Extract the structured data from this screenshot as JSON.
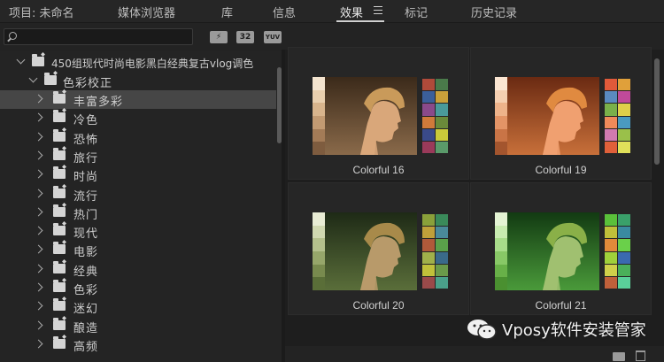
{
  "tabs": [
    {
      "label": "项目: 未命名",
      "active": false
    },
    {
      "label": "媒体浏览器",
      "active": false
    },
    {
      "label": "库",
      "active": false
    },
    {
      "label": "信息",
      "active": false
    },
    {
      "label": "效果",
      "active": true
    },
    {
      "label": "标记",
      "active": false
    },
    {
      "label": "历史记录",
      "active": false
    }
  ],
  "toolbar": {
    "search_value": "",
    "btn_accelerated": "⚡",
    "btn_32": "32",
    "btn_yuv": "YUV"
  },
  "tree": {
    "root_label": "450组现代时尚电影黑白经典复古vlog调色",
    "group_label": "色彩校正",
    "items": [
      {
        "label": "丰富多彩",
        "selected": true
      },
      {
        "label": "冷色",
        "selected": false
      },
      {
        "label": "恐怖",
        "selected": false
      },
      {
        "label": "旅行",
        "selected": false
      },
      {
        "label": "时尚",
        "selected": false
      },
      {
        "label": "流行",
        "selected": false
      },
      {
        "label": "热门",
        "selected": false
      },
      {
        "label": "现代",
        "selected": false
      },
      {
        "label": "电影",
        "selected": false
      },
      {
        "label": "经典",
        "selected": false
      },
      {
        "label": "色彩",
        "selected": false
      },
      {
        "label": "迷幻",
        "selected": false
      },
      {
        "label": "酿造",
        "selected": false
      },
      {
        "label": "高频",
        "selected": false
      }
    ]
  },
  "presets": [
    {
      "label": "Colorful 16",
      "bg_top": "#3b2a1a",
      "bg_bottom": "#8a6a4a",
      "skin": "#d9a77a",
      "hair": "#c99a5a",
      "swatches": [
        "#f4e4cf",
        "#e9cfae",
        "#d8b48c",
        "#c29a72",
        "#a37b57",
        "#7e5c3f"
      ],
      "checker": [
        "#b04a3a",
        "#4a7a4a",
        "#3b5f9a",
        "#c9a03a",
        "#8a4a8a",
        "#4a9a9a",
        "#d07a3a",
        "#6a8a3a",
        "#3a4a8a",
        "#c9c93a",
        "#9a3a5a",
        "#5a9a6a"
      ]
    },
    {
      "label": "Colorful 19",
      "bg_top": "#6a2a12",
      "bg_bottom": "#c8703a",
      "skin": "#f0a070",
      "hair": "#e08a40",
      "swatches": [
        "#fbe6d2",
        "#f5cfb0",
        "#eeb38a",
        "#e39466",
        "#c97446",
        "#a3552e"
      ],
      "checker": [
        "#e05a3a",
        "#e0a03a",
        "#5a8ac0",
        "#c04a9a",
        "#7ab04a",
        "#e0d04a",
        "#f08a5a",
        "#4a9ac0",
        "#d07ab0",
        "#9ac04a",
        "#e0603a",
        "#e0e05a"
      ]
    },
    {
      "label": "Colorful 20",
      "bg_top": "#1e2a16",
      "bg_bottom": "#5a6e3a",
      "skin": "#b89a6a",
      "hair": "#a88a4a",
      "swatches": [
        "#e8ecd4",
        "#d0d8b0",
        "#b4c08c",
        "#96a66a",
        "#788a4e",
        "#5a6e38"
      ],
      "checker": [
        "#8aa03a",
        "#3a8a5a",
        "#c0a03a",
        "#4a8a9a",
        "#b05a3a",
        "#5aa04a",
        "#a0b04a",
        "#3a6a8a",
        "#c0c03a",
        "#6a9a4a",
        "#9a4a4a",
        "#4aa08a"
      ]
    },
    {
      "label": "Colorful 21",
      "bg_top": "#123a12",
      "bg_bottom": "#4a9a3a",
      "skin": "#a0c070",
      "hair": "#8ab048",
      "swatches": [
        "#e4f4d4",
        "#c8ecb0",
        "#a8dc8a",
        "#88c866",
        "#68b048",
        "#4a9030"
      ],
      "checker": [
        "#5ac03a",
        "#3aa06a",
        "#c0c03a",
        "#3a8aa0",
        "#e08a3a",
        "#6ad04a",
        "#a0d03a",
        "#3a6ab0",
        "#d0d04a",
        "#4ab05a",
        "#c0603a",
        "#5ad09a"
      ]
    }
  ],
  "watermark": {
    "text": "Vposy软件安装管家"
  }
}
